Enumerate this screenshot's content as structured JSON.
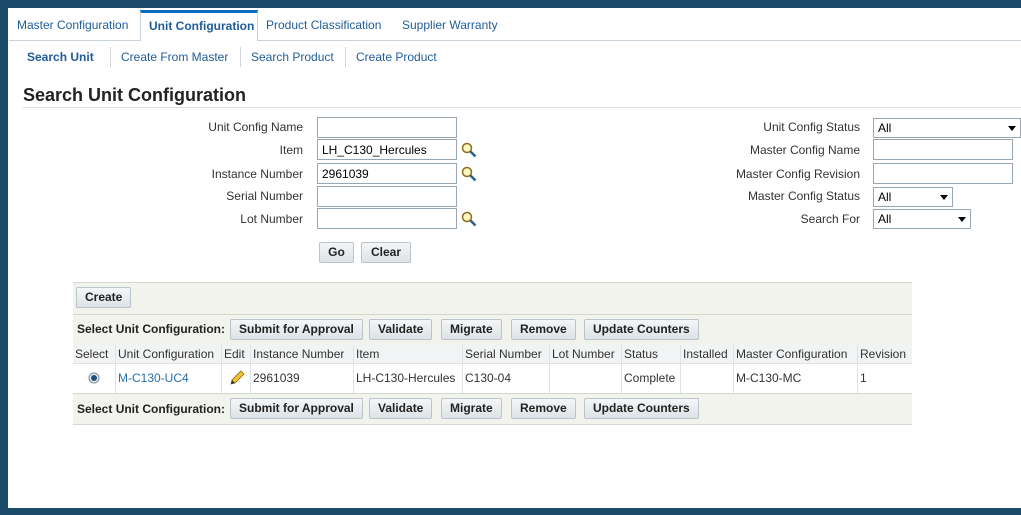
{
  "tabs": [
    {
      "label": "Master Configuration"
    },
    {
      "label": "Unit Configuration",
      "active": true
    },
    {
      "label": "Product Classification"
    },
    {
      "label": "Supplier Warranty"
    }
  ],
  "subtabs": [
    {
      "label": "Search Unit",
      "active": true
    },
    {
      "label": "Create From Master"
    },
    {
      "label": "Search Product"
    },
    {
      "label": "Create Product"
    }
  ],
  "page_title": "Search Unit Configuration",
  "search": {
    "unit_config_name": {
      "label": "Unit Config Name",
      "value": ""
    },
    "item": {
      "label": "Item",
      "value": "LH_C130_Hercules"
    },
    "instance_number": {
      "label": "Instance Number",
      "value": "2961039"
    },
    "serial_number": {
      "label": "Serial Number",
      "value": ""
    },
    "lot_number": {
      "label": "Lot Number",
      "value": ""
    },
    "unit_config_status": {
      "label": "Unit Config Status",
      "value": "All"
    },
    "master_config_name": {
      "label": "Master Config Name",
      "value": ""
    },
    "master_config_revision": {
      "label": "Master Config Revision",
      "value": ""
    },
    "master_config_status": {
      "label": "Master Config Status",
      "value": "All"
    },
    "search_for": {
      "label": "Search For",
      "value": "All"
    },
    "go": "Go",
    "clear": "Clear"
  },
  "results": {
    "create": "Create",
    "select_label": "Select Unit Configuration:",
    "actions": [
      "Submit for Approval",
      "Validate",
      "Migrate",
      "Remove",
      "Update Counters"
    ],
    "columns": [
      "Select",
      "Unit Configuration",
      "Edit",
      "Instance Number",
      "Item",
      "Serial Number",
      "Lot Number",
      "Status",
      "Installed",
      "Master Configuration",
      "Revision"
    ],
    "rows": [
      {
        "selected": true,
        "unit_configuration": "M-C130-UC4",
        "instance_number": "2961039",
        "item": "LH-C130-Hercules",
        "serial_number": "C130-04",
        "lot_number": "",
        "status": "Complete",
        "installed": "",
        "master_configuration": "M-C130-MC",
        "revision": "1"
      }
    ]
  }
}
